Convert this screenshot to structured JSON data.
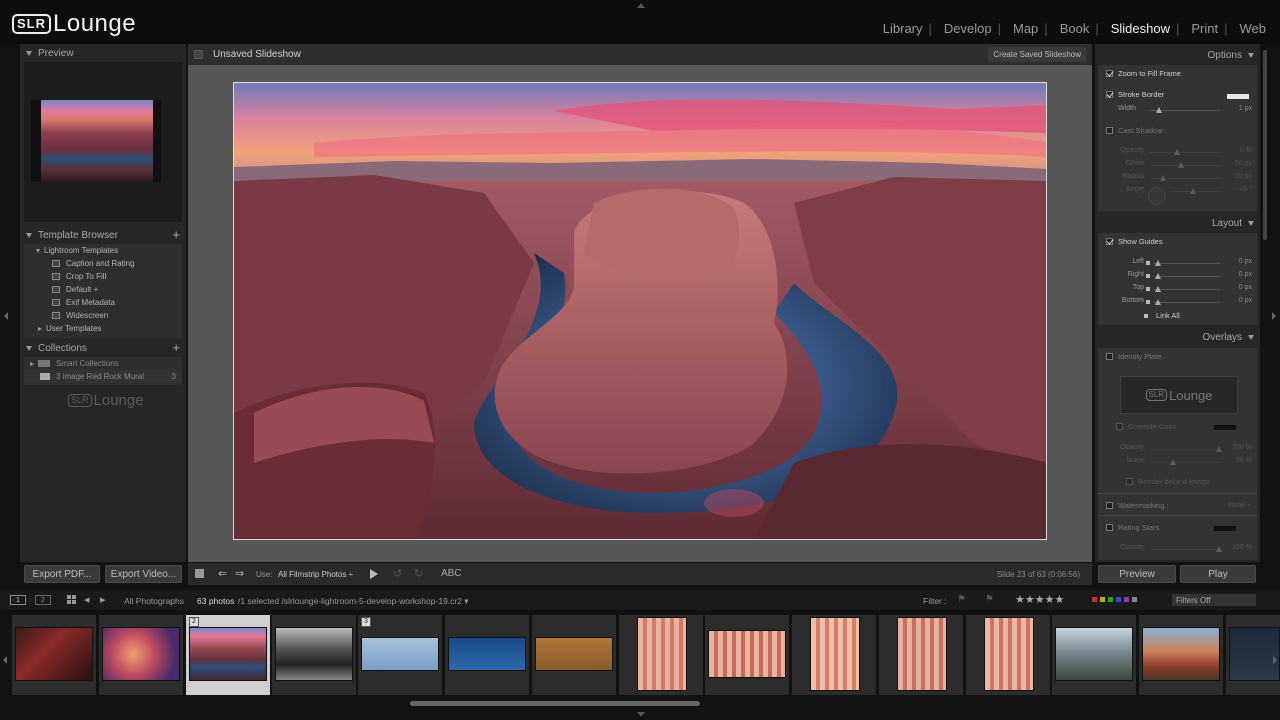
{
  "brand": {
    "badge": "SLR",
    "name": "Lounge"
  },
  "modules": [
    "Library",
    "Develop",
    "Map",
    "Book",
    "Slideshow",
    "Print",
    "Web"
  ],
  "active_module": "Slideshow",
  "left_panel": {
    "preview_title": "Preview",
    "template_browser_title": "Template Browser",
    "template_folder": "Lightroom Templates",
    "templates": [
      "Caption and Rating",
      "Crop To Fill",
      "Default +",
      "Exif Metadata",
      "Widescreen"
    ],
    "user_templates": "User Templates",
    "collections_title": "Collections",
    "smart_collections": "Smart Collections",
    "collection_item": "3 image Red Rock Mural",
    "collection_count": "3",
    "export_pdf": "Export PDF...",
    "export_video": "Export Video..."
  },
  "center": {
    "title": "Unsaved Slideshow",
    "create_saved": "Create Saved Slideshow"
  },
  "right_panel": {
    "options_title": "Options",
    "zoom_to_fill": "Zoom to Fill Frame",
    "stroke_border": "Stroke Border",
    "width_label": "Width",
    "width_value": "1 px",
    "cast_shadow": "Cast Shadow",
    "shadow_sliders": [
      {
        "label": "Opacity",
        "value": "0 %"
      },
      {
        "label": "Offset",
        "value": "50 px"
      },
      {
        "label": "Radius",
        "value": "10 px"
      },
      {
        "label": "Angle",
        "value": "-45 °"
      }
    ],
    "layout_title": "Layout",
    "show_guides": "Show Guides",
    "layout_sliders": [
      {
        "label": "Left",
        "value": "0 px"
      },
      {
        "label": "Right",
        "value": "0 px"
      },
      {
        "label": "Top",
        "value": "0 px"
      },
      {
        "label": "Bottom",
        "value": "0 px"
      }
    ],
    "link_all": "Link All",
    "overlays_title": "Overlays",
    "identity_plate": "Identity Plate",
    "override_color": "Override Color",
    "plate_sliders": [
      {
        "label": "Opacity",
        "value": "100 %"
      },
      {
        "label": "Scale",
        "value": "90 %"
      }
    ],
    "render_behind": "Render behind image",
    "watermarking": "Watermarking :",
    "watermark_value": "None ÷",
    "rating_stars": "Rating Stars",
    "rating_opacity_label": "Opacity",
    "rating_opacity_value": "100 %",
    "preview_btn": "Preview",
    "play_btn": "Play"
  },
  "toolbar": {
    "use_label": "Use:",
    "use_value": "All Filmstrip Photos ÷",
    "abc": "ABC",
    "slide_info": "Slide 23 of 63 (0:06:56)"
  },
  "filmstrip_bar": {
    "monitor1": "1",
    "monitor2": "2",
    "source": "All Photographs",
    "count": "63 photos",
    "detail": "/1 selected /slrlounge-lightroom-5-develop-workshop-19.cr2 ▾",
    "filter_label": "Filter :",
    "stars": "★★★★★",
    "filter_value": "Filters Off"
  },
  "filmstrip": {
    "badges": {
      "selected": "2",
      "stack": "3"
    }
  },
  "colors": {
    "accent_active": "#f0f0f0",
    "panel_bg": "#262626",
    "canvas_bg": "#575757",
    "selected_cell": "#cfcfcf"
  }
}
